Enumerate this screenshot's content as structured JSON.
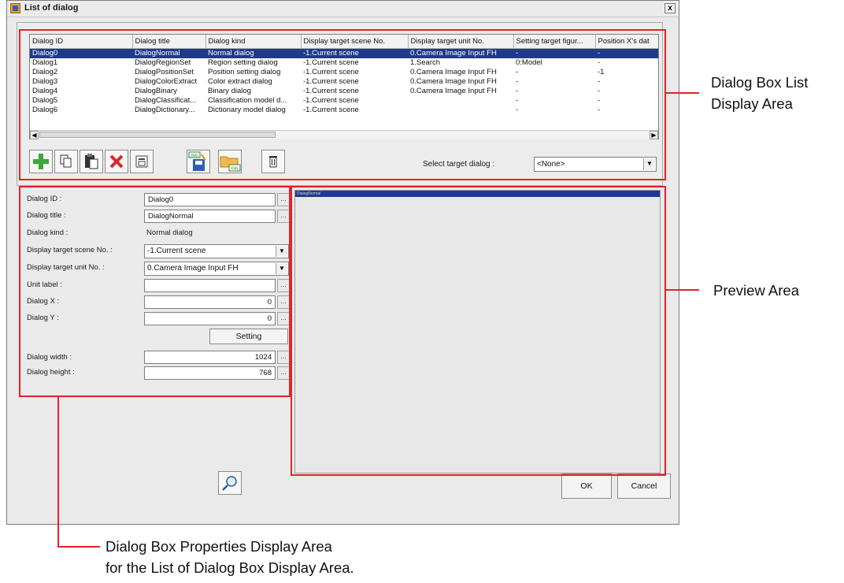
{
  "window": {
    "title": "List of dialog",
    "close": "x"
  },
  "grid": {
    "headers": [
      "Dialog ID",
      "Dialog title",
      "Dialog kind",
      "Display target scene No.",
      "Display target unit No.",
      "Setting target figur...",
      "Position X's dat"
    ],
    "rows": [
      [
        "Dialog0",
        "DialogNormal",
        "Normal dialog",
        "-1.Current scene",
        "0.Camera Image Input FH",
        "-",
        "-"
      ],
      [
        "Dialog1",
        "DialogRegionSet",
        "Region setting dialog",
        "-1.Current scene",
        "1.Search",
        "0:Model",
        "-"
      ],
      [
        "Dialog2",
        "DialogPositionSet",
        "Position setting dialog",
        "-1.Current scene",
        "0.Camera Image Input FH",
        "-",
        "-1"
      ],
      [
        "Dialog3",
        "DialogColorExtract",
        "Color extract dialog",
        "-1.Current scene",
        "0.Camera Image Input FH",
        "-",
        "-"
      ],
      [
        "Dialog4",
        "DialogBinary",
        "Binary dialog",
        "-1.Current scene",
        "0.Camera Image Input FH",
        "-",
        "-"
      ],
      [
        "Dialog5",
        "DialogClassificat...",
        "Classification model d...",
        "-1.Current scene",
        "",
        "-",
        "-"
      ],
      [
        "Dialog6",
        "DialogDictionary...",
        "Dictionary model dialog",
        "-1.Current scene",
        "",
        "-",
        "-"
      ]
    ],
    "selected_row": 0
  },
  "toolbar": {
    "xml_badge": "XML",
    "select_target_label": "Select target dialog :",
    "select_target_value": "<None>"
  },
  "props": {
    "dialog_id_label": "Dialog ID :",
    "dialog_id_value": "Dialog0",
    "dialog_title_label": "Dialog title :",
    "dialog_title_value": "DialogNormal",
    "dialog_kind_label": "Dialog kind :",
    "dialog_kind_value": "Normal dialog",
    "scene_label": "Display target scene No. :",
    "scene_value": "-1.Current scene",
    "unit_label": "Display target unit No. :",
    "unit_value": "0.Camera Image Input FH",
    "unit_label_label": "Unit label :",
    "unit_label_value": "",
    "dialog_x_label": "Dialog X :",
    "dialog_x_value": "0",
    "dialog_y_label": "Dialog Y :",
    "dialog_y_value": "0",
    "setting_button": "Setting",
    "width_label": "Dialog width :",
    "width_value": "1024",
    "height_label": "Dialog height :",
    "height_value": "768",
    "ellipsis": "..."
  },
  "preview": {
    "header": "DialogNormal"
  },
  "buttons": {
    "ok": "OK",
    "cancel": "Cancel"
  },
  "callouts": {
    "list_area": [
      "Dialog Box List",
      "Display Area"
    ],
    "preview_area": "Preview Area",
    "props_area": [
      "Dialog Box Properties Display Area",
      "for the List of Dialog Box Display Area."
    ]
  },
  "colors": {
    "highlight_red": "#e0242a",
    "selection_blue": "#1f3a8a"
  }
}
